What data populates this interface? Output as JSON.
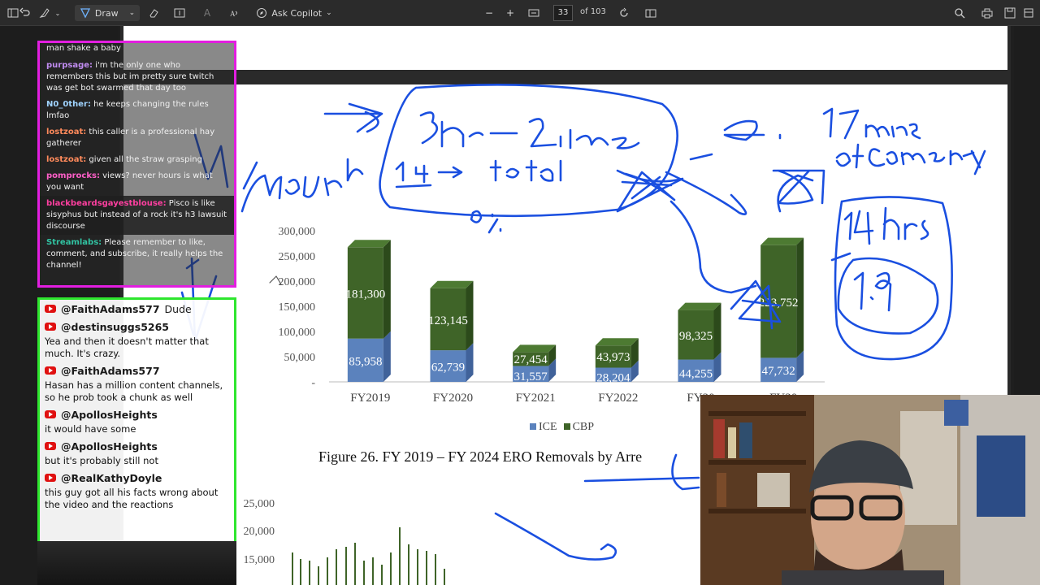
{
  "toolbar": {
    "draw_label": "Draw",
    "copilot_label": "Ask Copilot",
    "page_current": "33",
    "page_total": "of 103"
  },
  "figure": {
    "caption": "Figure 26. FY 2019 – FY 2024 ERO Removals by Arre"
  },
  "chart_data": [
    {
      "type": "bar",
      "stacked": true,
      "categories": [
        "FY2019",
        "FY2020",
        "FY2021",
        "FY2022",
        "FY20",
        "FY20"
      ],
      "series": [
        {
          "name": "ICE",
          "values": [
            85958,
            62739,
            31557,
            28204,
            44255,
            47732
          ],
          "labels": [
            "85,958",
            "62,739",
            "31,557",
            "28,204",
            "44,255",
            "47,732"
          ],
          "color": "#5b82bd"
        },
        {
          "name": "CBP",
          "values": [
            181300,
            123145,
            27454,
            43973,
            98325,
            223752
          ],
          "labels": [
            "181,300",
            "123,145",
            "27,454",
            "43,973",
            "98,325",
            "223,752"
          ],
          "color": "#3f6428"
        }
      ],
      "y_ticks": [
        "-",
        "50,000",
        "100,000",
        "150,000",
        "200,000",
        "250,000",
        "300,000"
      ],
      "y_tick_values": [
        0,
        50000,
        100000,
        150000,
        200000,
        250000,
        300000
      ],
      "ylim": [
        0,
        300000
      ],
      "legend": [
        "ICE",
        "CBP"
      ],
      "legend_position": "bottom"
    },
    {
      "type": "bar",
      "y_ticks": [
        "25,000",
        "20,000",
        "15,000"
      ],
      "y_tick_values": [
        25000,
        20000,
        15000
      ],
      "visible_partial": true
    }
  ],
  "annotations": {
    "ink_color": "#1a4fe0",
    "notes": [
      "3hr – 2untime",
      "1.4 -> total",
      "0%",
      "2. 17mins",
      "of Commentary",
      "14 hrs",
      "1.9",
      "Anyun"
    ]
  },
  "chat_top": {
    "border_color": "#e21ee0",
    "messages": [
      {
        "user": "",
        "text": "man shake a baby",
        "user_color": "#ffffff"
      },
      {
        "user": "purpsage",
        "text": " i'm the only one who remembers this but im pretty sure twitch was get bot swarmed that day too",
        "user_color": "#c08cf0"
      },
      {
        "user": "N0_0ther",
        "text": " he keeps changing the rules lmfao",
        "user_color": "#9fd3ff"
      },
      {
        "user": "lostzoat",
        "text": " this caller is a professional hay gatherer",
        "user_color": "#ff8a5b"
      },
      {
        "user": "lostzoat",
        "text": " given all the straw grasping",
        "user_color": "#ff8a5b"
      },
      {
        "user": "pomprocks",
        "text": " views? never hours is what you want",
        "user_color": "#ff5fc8"
      },
      {
        "user": "blackbeardsgayestblouse",
        "text": " Pisco is like sisyphus but instead of a rock it's h3 lawsuit discourse",
        "user_color": "#ff3fa0"
      },
      {
        "user": "Streamlabs",
        "text": " Please remember to like, comment, and subscribe, it really helps the channel!",
        "user_color": "#31c3a2"
      }
    ]
  },
  "chat_bottom": {
    "border_color": "#2ee62e",
    "messages": [
      {
        "handle": "@FaithAdams577",
        "text": "Dude"
      },
      {
        "handle": "@destinsuggs5265",
        "text": "Yea and then it doesn't matter that much. It's crazy."
      },
      {
        "handle": "@FaithAdams577",
        "text": "Hasan has a million content channels, so he prob took a chunk as well"
      },
      {
        "handle": "@ApollosHeights",
        "text": "it would have some"
      },
      {
        "handle": "@ApollosHeights",
        "text": "but it's probably still not"
      },
      {
        "handle": "@RealKathyDoyle",
        "text": "this guy got all his facts wrong about the video and the reactions"
      }
    ]
  }
}
